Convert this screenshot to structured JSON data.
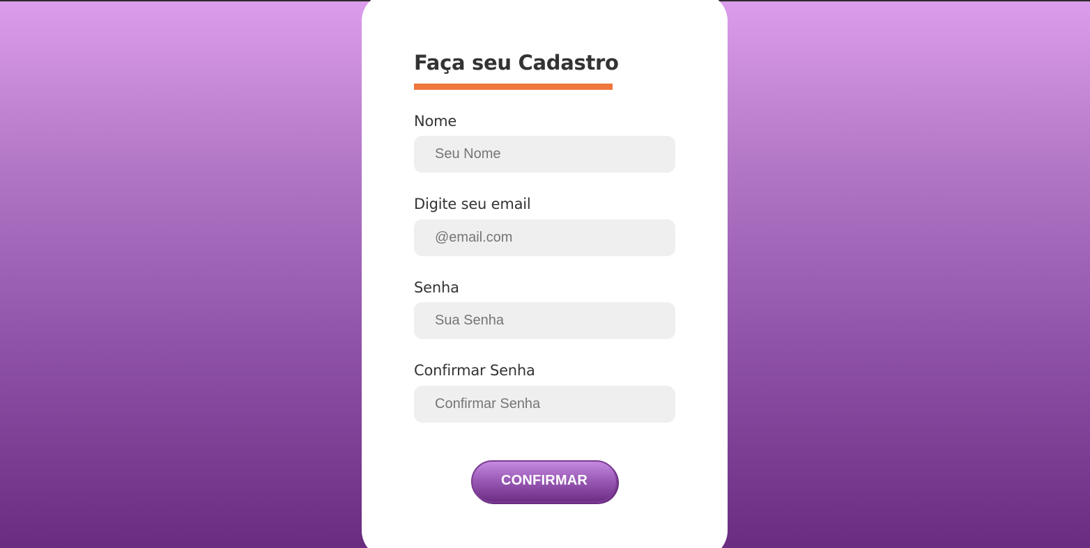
{
  "form": {
    "title": "Faça seu Cadastro",
    "fields": [
      {
        "label": "Nome",
        "placeholder": "Seu Nome",
        "value": ""
      },
      {
        "label": "Digite seu email",
        "placeholder": "@email.com",
        "value": ""
      },
      {
        "label": "Senha",
        "placeholder": "Sua Senha",
        "value": ""
      },
      {
        "label": "Confirmar Senha",
        "placeholder": "Confirmar Senha",
        "value": ""
      }
    ],
    "submit_label": "CONFIRMAR"
  },
  "colors": {
    "background_top": "#dc9dec",
    "background_bottom": "#692c7f",
    "card": "#ffffff",
    "accent_underline": "#f0773d",
    "input_background": "#efefef",
    "button_gradient_top": "#c58adf",
    "button_gradient_bottom": "#6e2e85",
    "text": "#333333"
  }
}
